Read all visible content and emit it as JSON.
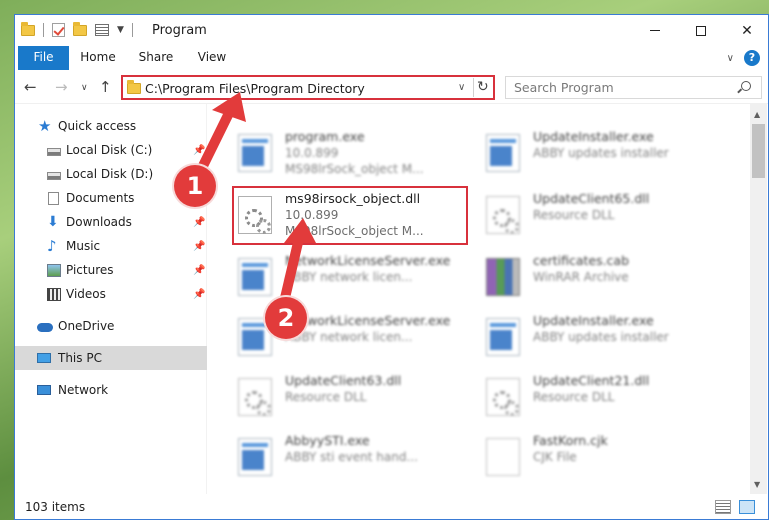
{
  "window": {
    "title": "Program",
    "colors": {
      "accent": "#1979ca",
      "highlight_border": "#d8313c",
      "badge": "#e23b3b"
    }
  },
  "ribbon": {
    "tabs": [
      "File",
      "Home",
      "Share",
      "View"
    ]
  },
  "address_bar": {
    "path": "C:\\Program Files\\Program Directory"
  },
  "search": {
    "placeholder": "Search Program"
  },
  "sidebar": {
    "items": [
      {
        "label": "Quick access",
        "icon": "star-icon"
      },
      {
        "label": "Local Disk (C:)",
        "icon": "drive-icon",
        "pinned": true
      },
      {
        "label": "Local Disk (D:)",
        "icon": "drive-icon",
        "pinned": true
      },
      {
        "label": "Documents",
        "icon": "documents-icon",
        "pinned": true
      },
      {
        "label": "Downloads",
        "icon": "download-icon",
        "pinned": true
      },
      {
        "label": "Music",
        "icon": "music-icon",
        "pinned": true
      },
      {
        "label": "Pictures",
        "icon": "pictures-icon",
        "pinned": true
      },
      {
        "label": "Videos",
        "icon": "videos-icon",
        "pinned": true
      },
      {
        "label": "OneDrive",
        "icon": "onedrive-icon"
      },
      {
        "label": "This PC",
        "icon": "pc-icon",
        "selected": true
      },
      {
        "label": "Network",
        "icon": "network-icon"
      }
    ]
  },
  "files": [
    {
      "name": "program.exe",
      "line2": "10.0.899",
      "line3": "MS98lrSock_object M...",
      "icon": "exe-icon"
    },
    {
      "name": "UpdateInstaller.exe",
      "line2": "ABBY updates installer",
      "line3": "",
      "icon": "exe-icon"
    },
    {
      "name": "ms98irsock_object.dll",
      "line2": "10.0.899",
      "line3": "MS98lrSock_object M...",
      "icon": "dll-icon"
    },
    {
      "name": "UpdateClient65.dll",
      "line2": "Resource DLL",
      "line3": "",
      "icon": "dll-icon"
    },
    {
      "name": "NetworkLicenseServer.exe",
      "line2": "ABBY network licen...",
      "line3": "",
      "icon": "exe-icon"
    },
    {
      "name": "certificates.cab",
      "line2": "WinRAR Archive",
      "line3": "",
      "icon": "cab-icon"
    },
    {
      "name": "NetworkLicenseServer.exe",
      "line2": "ABBY network licen...",
      "line3": "",
      "icon": "exe-icon"
    },
    {
      "name": "UpdateInstaller.exe",
      "line2": "ABBY updates installer",
      "line3": "",
      "icon": "exe-icon"
    },
    {
      "name": "UpdateClient63.dll",
      "line2": "Resource DLL",
      "line3": "",
      "icon": "dll-icon"
    },
    {
      "name": "UpdateClient21.dll",
      "line2": "Resource DLL",
      "line3": "",
      "icon": "dll-icon"
    },
    {
      "name": "AbbyySTI.exe",
      "line2": "ABBY sti event hand...",
      "line3": "",
      "icon": "exe-icon"
    },
    {
      "name": "FastKorn.cjk",
      "line2": "CJK File",
      "line3": "",
      "icon": "cjk-icon"
    }
  ],
  "status": {
    "item_count": "103 items"
  },
  "annotations": {
    "badge1": "1",
    "badge2": "2"
  }
}
